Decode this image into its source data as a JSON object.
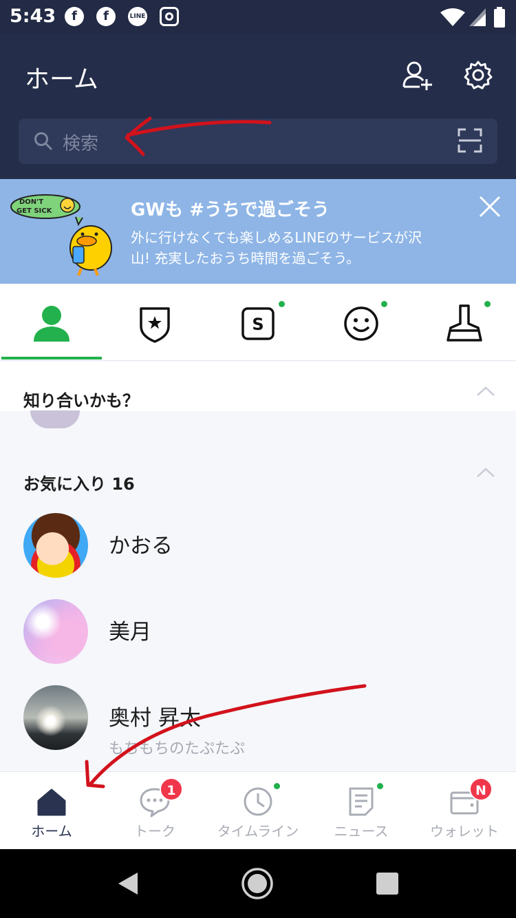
{
  "status_bar": {
    "time": "5:43",
    "icons": [
      "facebook-icon",
      "facebook-icon",
      "line-icon",
      "instagram-icon",
      "wifi-icon",
      "signal-icon",
      "battery-icon"
    ],
    "line_label": "LINE"
  },
  "header": {
    "title": "ホーム",
    "add_friend_icon": "add-friend-icon",
    "settings_icon": "gear-icon"
  },
  "search": {
    "placeholder": "検索",
    "scan_icon": "qr-scan-icon"
  },
  "banner": {
    "title": "GWも #うちで過ごそう",
    "text": "外に行けなくても楽しめるLINEのサービスが沢山! 充実したおうち時間を過ごそう。",
    "sticker_text": "DON'T GET SICK",
    "bg_color": "#8eb5e6"
  },
  "tabs": [
    {
      "icon": "friends-icon",
      "active": true
    },
    {
      "icon": "official-account-icon"
    },
    {
      "icon": "sticker-shop-icon",
      "new": true
    },
    {
      "icon": "emoji-icon",
      "new": true
    },
    {
      "icon": "theme-icon",
      "new": true
    }
  ],
  "sections": {
    "suggested": {
      "title": "知り合いかも？"
    },
    "favorites": {
      "title": "お気に入り 16"
    }
  },
  "favorites": [
    {
      "name": "かおる",
      "status": ""
    },
    {
      "name": "美月",
      "status": ""
    },
    {
      "name": "奥村 昇太",
      "status": "もちもちのたぷたぷ"
    }
  ],
  "bottom_nav": [
    {
      "label": "ホーム",
      "icon": "home-icon",
      "active": true
    },
    {
      "label": "トーク",
      "icon": "chat-icon",
      "badge": "1"
    },
    {
      "label": "タイムライン",
      "icon": "clock-icon"
    },
    {
      "label": "ニュース",
      "icon": "news-icon"
    },
    {
      "label": "ウォレット",
      "icon": "wallet-icon",
      "badge": "N"
    }
  ],
  "colors": {
    "header": "#242d4a",
    "accent_green": "#22b14c",
    "badge_red": "#f0364a",
    "annotation_red": "#d2121c"
  }
}
